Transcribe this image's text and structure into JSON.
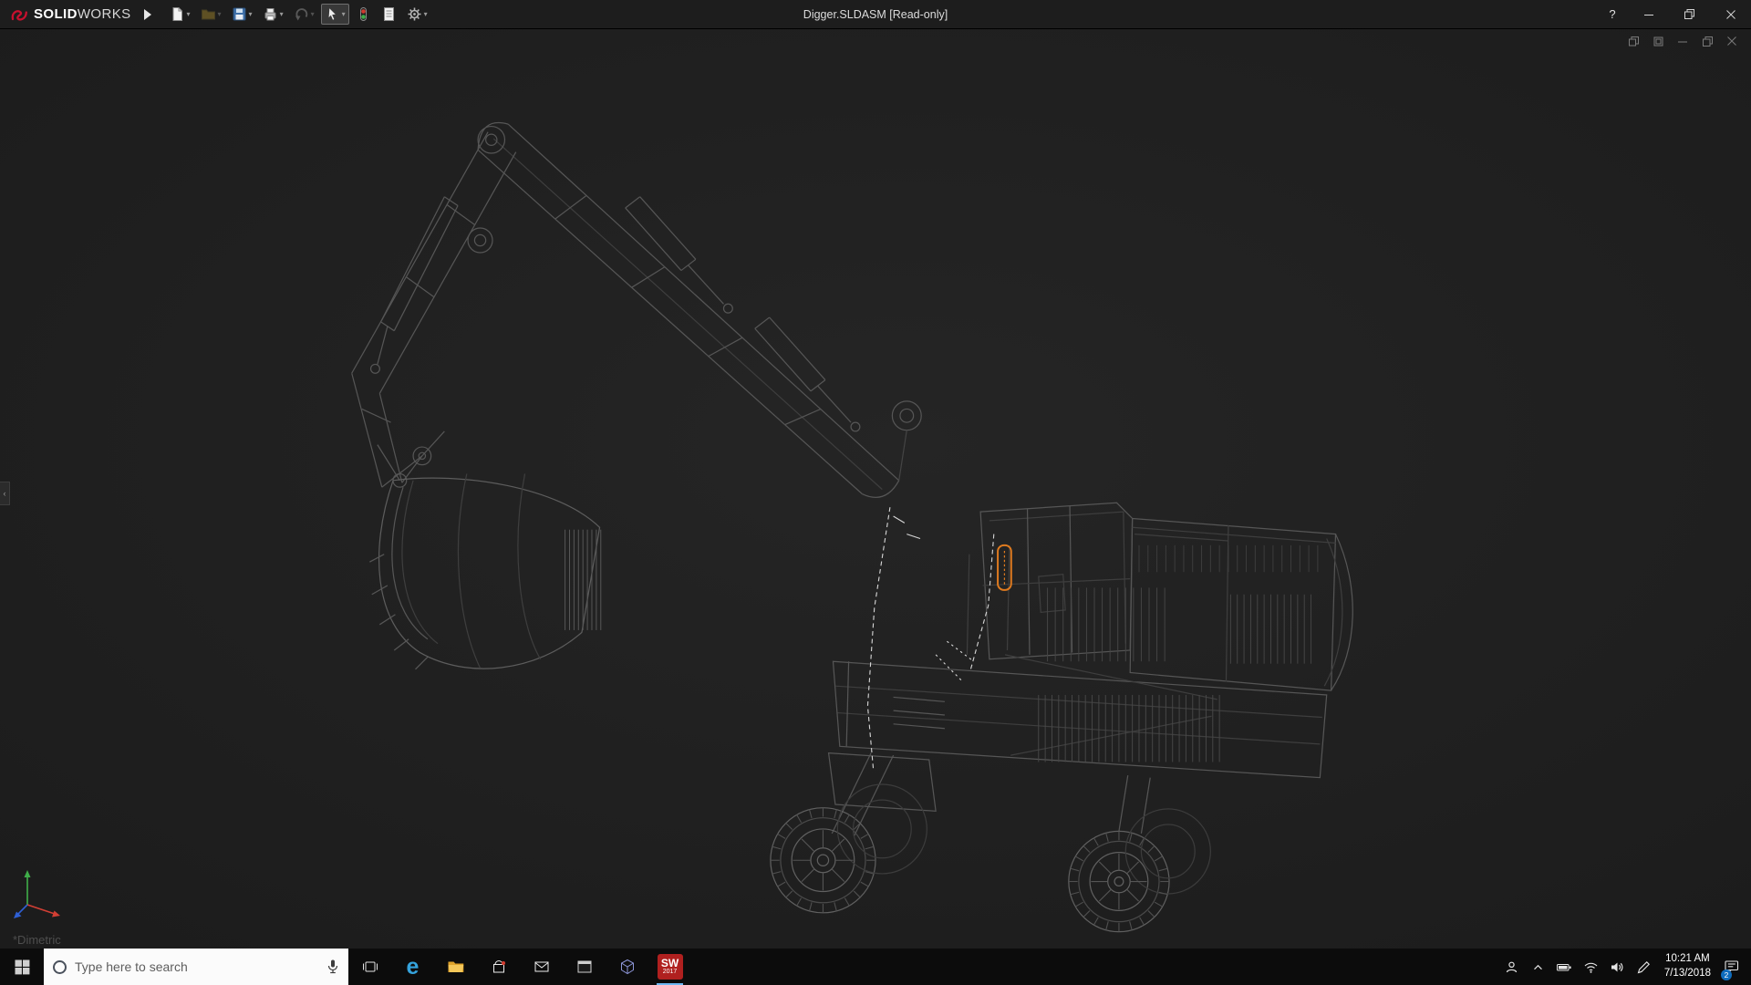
{
  "titlebar": {
    "brand_prefix": "SOLID",
    "brand_suffix": "WORKS",
    "document_title": "Digger.SLDASM [Read-only]",
    "help_glyph": "?",
    "window_controls": [
      "help",
      "minimize",
      "restore",
      "close"
    ]
  },
  "toolbar": {
    "icons": [
      "new-document",
      "open",
      "save",
      "print",
      "undo",
      "select",
      "rebuild",
      "file-properties",
      "options"
    ]
  },
  "viewport": {
    "orientation_label": "*Dimetric",
    "document_controls": [
      "window",
      "window",
      "minimize",
      "restore",
      "close"
    ],
    "highlighted_component_color": "#e07b1f"
  },
  "taskbar": {
    "search": {
      "placeholder": "Type here to search"
    },
    "apps": [
      "task-view",
      "edge",
      "file-explorer",
      "store",
      "mail",
      "terminal",
      "3d-viewer",
      "solidworks-2017"
    ],
    "edge_glyph": "e",
    "solidworks_label": "SW",
    "solidworks_year": "2017",
    "tray": {
      "time": "10:21 AM",
      "date": "7/13/2018",
      "notification_badge": "2"
    }
  },
  "colors": {
    "selection_orange": "#e07b1f",
    "axis_red": "#d23f34",
    "axis_green": "#3fae49",
    "axis_blue": "#2e5fd3",
    "taskbar_bg": "#0c0c0c",
    "titlebar_bg": "#1d1d1d",
    "viewport_bg": "#1e1e1e"
  }
}
